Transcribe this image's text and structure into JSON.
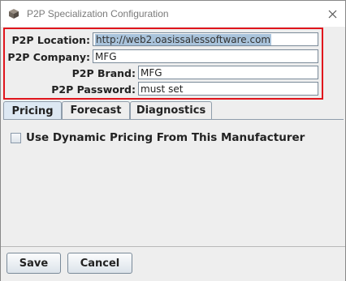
{
  "window": {
    "title": "P2P Specialization Configuration",
    "app_icon": "app-box-icon",
    "close_icon": "close-icon"
  },
  "fields": {
    "location": {
      "label": "P2P Location:",
      "value": "http://web2.oasissalessoftware.com",
      "selected": true
    },
    "company": {
      "label": "P2P Company:",
      "value": "MFG"
    },
    "brand": {
      "label": "P2P Brand:",
      "value": "MFG"
    },
    "password": {
      "label": "P2P Password:",
      "value": "must set"
    },
    "highlight_color": "#e0151c"
  },
  "tabs": [
    {
      "label": "Pricing",
      "active": true
    },
    {
      "label": "Forecast",
      "active": false
    },
    {
      "label": "Diagnostics",
      "active": false
    }
  ],
  "pricing": {
    "checkbox_label": "Use Dynamic Pricing From This Manufacturer",
    "checked": false
  },
  "footer": {
    "save_label": "Save",
    "cancel_label": "Cancel"
  }
}
